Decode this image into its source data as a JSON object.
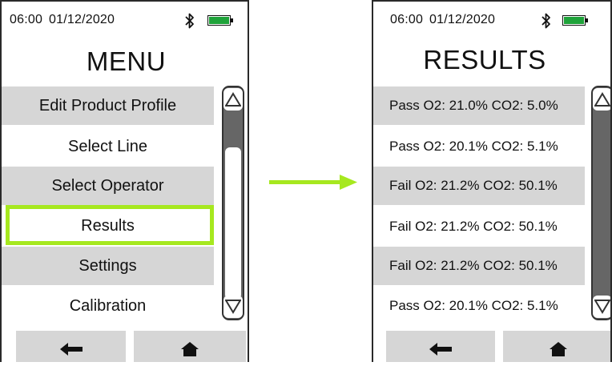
{
  "menu_screen": {
    "status": {
      "time": "06:00",
      "date": "01/12/2020"
    },
    "title": "MENU",
    "items": [
      {
        "label": "Edit Product Profile"
      },
      {
        "label": "Select Line"
      },
      {
        "label": "Select Operator"
      },
      {
        "label": "Results"
      },
      {
        "label": "Settings"
      },
      {
        "label": "Calibration"
      }
    ],
    "selected_item": "Results"
  },
  "results_screen": {
    "status": {
      "time": "06:00",
      "date": "01/12/2020"
    },
    "title": "RESULTS",
    "items": [
      {
        "label": "Pass O2: 21.0% CO2: 5.0%"
      },
      {
        "label": "Pass O2: 20.1% CO2: 5.1%"
      },
      {
        "label": "Fail O2: 21.2% CO2: 50.1%"
      },
      {
        "label": "Fail O2: 21.2% CO2: 50.1%"
      },
      {
        "label": "Fail O2: 21.2% CO2: 50.1%"
      },
      {
        "label": "Pass O2: 20.1% CO2: 5.1%"
      }
    ]
  },
  "icons": {
    "bluetooth": "bluetooth-icon",
    "battery": "battery-icon",
    "scroll_up": "triangle-up-icon",
    "scroll_down": "triangle-down-icon",
    "back": "arrow-left-icon",
    "home": "home-icon",
    "transition": "arrow-right-icon"
  },
  "colors": {
    "battery": "#1fa33a",
    "highlight": "#a6e81f",
    "transition_arrow": "#a6e81f",
    "row_shade": "#d6d6d6",
    "scrollbar": "#666666"
  }
}
